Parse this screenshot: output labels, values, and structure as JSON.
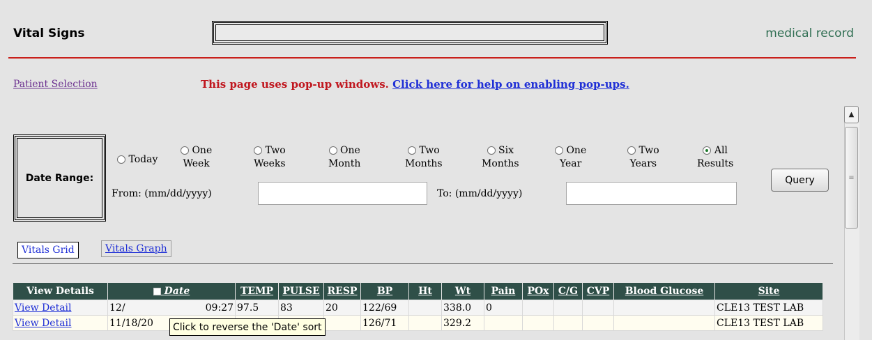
{
  "header": {
    "title": "Vital Signs",
    "brand": "medical record"
  },
  "links": {
    "patient_selection": "Patient Selection",
    "popup_notice": "This page uses pop-up windows.",
    "popup_help": "Click here for help on enabling pop-ups."
  },
  "date_range": {
    "label": "Date Range:",
    "options": [
      {
        "line1": "Today",
        "line2": "",
        "selected": false
      },
      {
        "line1": "One",
        "line2": "Week",
        "selected": false
      },
      {
        "line1": "Two",
        "line2": "Weeks",
        "selected": false
      },
      {
        "line1": "One",
        "line2": "Month",
        "selected": false
      },
      {
        "line1": "Two",
        "line2": "Months",
        "selected": false
      },
      {
        "line1": "Six",
        "line2": "Months",
        "selected": false
      },
      {
        "line1": "One",
        "line2": "Year",
        "selected": false
      },
      {
        "line1": "Two",
        "line2": "Years",
        "selected": false
      },
      {
        "line1": "All",
        "line2": "Results",
        "selected": true
      }
    ],
    "from_label": "From: (mm/dd/yyyy)",
    "from_value": "",
    "to_label": "To: (mm/dd/yyyy)",
    "to_value": "",
    "query_label": "Query"
  },
  "tabs": {
    "grid": "Vitals Grid",
    "graph": "Vitals Graph"
  },
  "table": {
    "headers": [
      "View Details",
      "Date",
      "TEMP",
      "PULSE",
      "RESP",
      "BP",
      "Ht",
      "Wt",
      "Pain",
      "POx",
      "C/G",
      "CVP",
      "Blood Glucose",
      "Site"
    ],
    "rows": [
      {
        "view": "View Detail",
        "date": "12/",
        "time": "09:27",
        "temp": "97.5",
        "pulse": "83",
        "resp": "20",
        "bp": "122/69",
        "ht": "",
        "wt": "338.0",
        "pain": "0",
        "pox": "",
        "cg": "",
        "cvp": "",
        "glucose": "",
        "site": "CLE13 TEST LAB"
      },
      {
        "view": "View Detail",
        "date": "11/18/20",
        "time": "",
        "temp": "",
        "pulse": "",
        "resp": "",
        "bp": "126/71",
        "ht": "",
        "wt": "329.2",
        "pain": "",
        "pox": "",
        "cg": "",
        "cvp": "",
        "glucose": "",
        "site": "CLE13 TEST LAB"
      }
    ]
  },
  "tooltip": "Click to reverse the 'Date' sort",
  "scrollbar": {
    "up_arrow": "▲",
    "thumb_grip": "≡"
  }
}
